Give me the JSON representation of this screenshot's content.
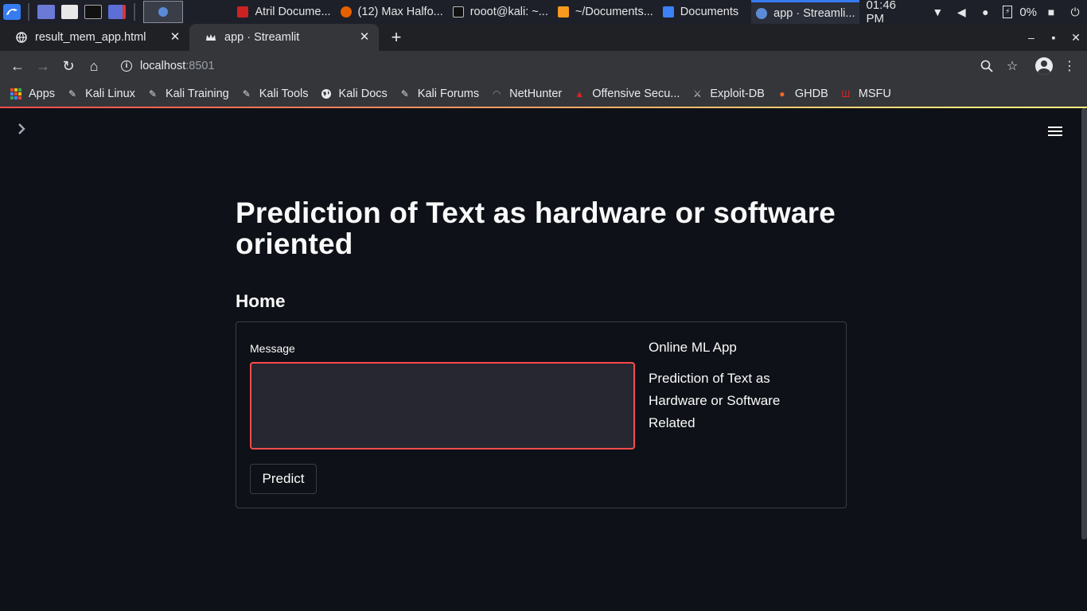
{
  "taskbar": {
    "tasks": [
      {
        "label": "Atril Docume...",
        "badge": "2"
      },
      {
        "label": "(12) Max Halfo..."
      },
      {
        "label": "rooot@kali: ~..."
      },
      {
        "label": "~/Documents..."
      },
      {
        "label": "Documents"
      },
      {
        "label": "app · Streamli..."
      }
    ],
    "clock": "01:46 PM",
    "battery": "0%"
  },
  "browser": {
    "tabs": [
      {
        "label": "result_mem_app.html"
      },
      {
        "label": "app · Streamlit"
      }
    ],
    "url_host": "localhost",
    "url_port": ":8501",
    "bookmarks": [
      {
        "label": "Apps"
      },
      {
        "label": "Kali Linux"
      },
      {
        "label": "Kali Training"
      },
      {
        "label": "Kali Tools"
      },
      {
        "label": "Kali Docs"
      },
      {
        "label": "Kali Forums"
      },
      {
        "label": "NetHunter"
      },
      {
        "label": "Offensive Secu..."
      },
      {
        "label": "Exploit-DB"
      },
      {
        "label": "GHDB"
      },
      {
        "label": "MSFU"
      }
    ]
  },
  "app": {
    "title": "Prediction of Text as hardware or software oriented",
    "subheader": "Home",
    "form": {
      "message_label": "Message",
      "message_value": "",
      "predict_label": "Predict"
    },
    "sidebar_info": {
      "title": "Online ML App",
      "text": "Prediction of Text as Hardware or Software Related"
    }
  },
  "colors": {
    "background": "#0e1117",
    "accent": "#ff4b4b",
    "input_bg": "#262730"
  }
}
